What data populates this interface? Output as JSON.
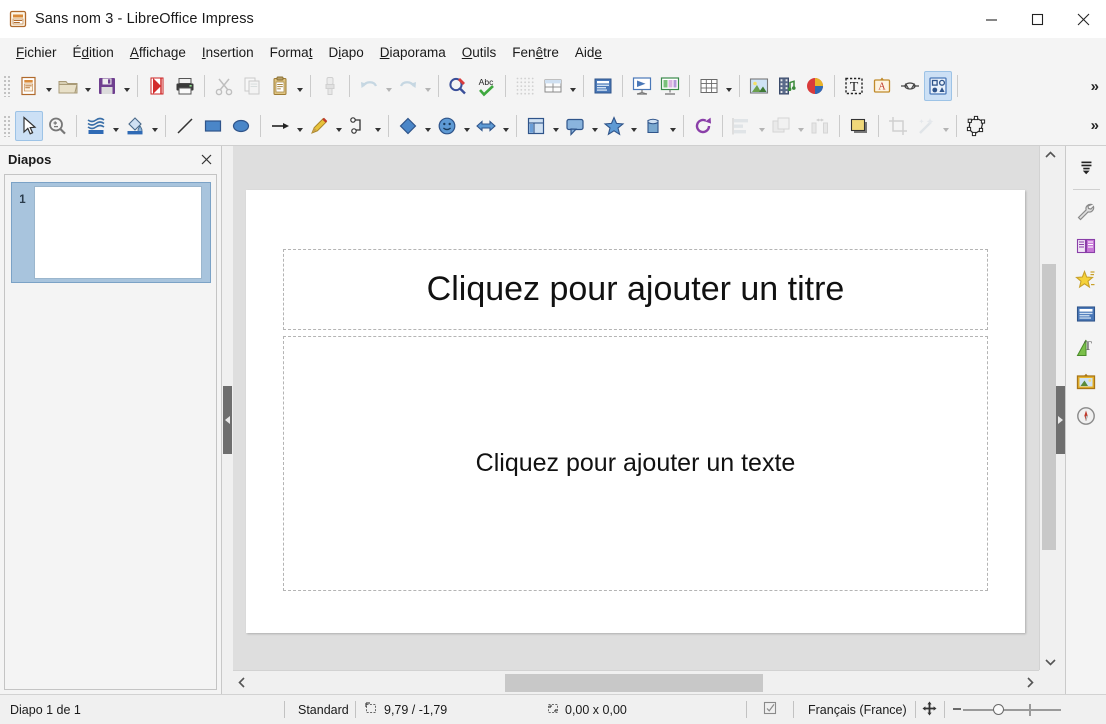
{
  "window": {
    "title": "Sans nom 3 - LibreOffice Impress",
    "app_icon": "impress-document-icon",
    "minimize_label": "—",
    "maximize_label": "□",
    "close_label": "✕"
  },
  "menubar": {
    "items": [
      {
        "name": "menu-fichier",
        "label": "Fichier",
        "accel_index": 0
      },
      {
        "name": "menu-edition",
        "label": "Édition",
        "accel_index": 1
      },
      {
        "name": "menu-affichage",
        "label": "Affichage",
        "accel_index": 0
      },
      {
        "name": "menu-insertion",
        "label": "Insertion",
        "accel_index": 0
      },
      {
        "name": "menu-format",
        "label": "Format",
        "accel_index": 5
      },
      {
        "name": "menu-diapo",
        "label": "Diapo",
        "accel_index": 1
      },
      {
        "name": "menu-diaporama",
        "label": "Diaporama",
        "accel_index": 0
      },
      {
        "name": "menu-outils",
        "label": "Outils",
        "accel_index": 0
      },
      {
        "name": "menu-fenetre",
        "label": "Fenêtre",
        "accel_index": 3
      },
      {
        "name": "menu-aide",
        "label": "Aide",
        "accel_index": 3
      }
    ]
  },
  "toolbar_standard": {
    "overflow_label": "»",
    "buttons": [
      {
        "name": "new-document-button",
        "icon": "new-document-icon",
        "dropdown": true,
        "enabled": true
      },
      {
        "name": "open-button",
        "icon": "open-folder-icon",
        "dropdown": true,
        "enabled": true
      },
      {
        "name": "save-button",
        "icon": "floppy-save-icon",
        "dropdown": true,
        "enabled": true
      },
      {
        "name": "export-pdf-button",
        "icon": "pdf-export-icon",
        "enabled": true
      },
      {
        "name": "print-button",
        "icon": "printer-icon",
        "enabled": true
      },
      {
        "name": "cut-button",
        "icon": "scissors-icon",
        "enabled": false
      },
      {
        "name": "copy-button",
        "icon": "copy-icon",
        "enabled": false
      },
      {
        "name": "paste-button",
        "icon": "clipboard-paste-icon",
        "dropdown": true,
        "enabled": true
      },
      {
        "name": "clone-formatting-button",
        "icon": "paintbrush-icon",
        "enabled": false
      },
      {
        "name": "undo-button",
        "icon": "undo-arrow-icon",
        "dropdown": true,
        "enabled": false
      },
      {
        "name": "redo-button",
        "icon": "redo-arrow-icon",
        "dropdown": true,
        "enabled": false
      },
      {
        "name": "find-replace-button",
        "icon": "magnifier-pencil-icon",
        "enabled": true
      },
      {
        "name": "spelling-button",
        "icon": "abc-check-icon",
        "enabled": true
      },
      {
        "name": "display-grid-button",
        "icon": "grid-dots-icon",
        "enabled": false
      },
      {
        "name": "display-views-button",
        "icon": "table-view-icon",
        "dropdown": true,
        "enabled": true
      },
      {
        "name": "master-slide-button",
        "icon": "master-slide-icon",
        "enabled": true
      },
      {
        "name": "start-from-first-slide-button",
        "icon": "presentation-screen-icon",
        "enabled": true
      },
      {
        "name": "start-from-current-slide-button",
        "icon": "presentation-columns-icon",
        "enabled": true
      },
      {
        "name": "insert-table-button",
        "icon": "table-grid-icon",
        "dropdown": true,
        "enabled": true
      },
      {
        "name": "insert-image-button",
        "icon": "picture-icon",
        "enabled": true
      },
      {
        "name": "insert-media-button",
        "icon": "film-audio-icon",
        "enabled": true
      },
      {
        "name": "insert-chart-button",
        "icon": "pie-chart-icon",
        "enabled": true
      },
      {
        "name": "insert-text-box-button",
        "icon": "text-box-icon",
        "enabled": true
      },
      {
        "name": "fontwork-button",
        "icon": "fontwork-a-icon",
        "enabled": true
      },
      {
        "name": "hyperlink-button",
        "icon": "hyperlink-chain-icon",
        "enabled": true
      },
      {
        "name": "gallery-button",
        "icon": "gallery-shapes-icon",
        "enabled": true,
        "active": true
      }
    ]
  },
  "toolbar_drawing": {
    "overflow_label": "»",
    "buttons": [
      {
        "name": "select-tool-button",
        "icon": "cursor-arrow-icon",
        "enabled": true,
        "active": true
      },
      {
        "name": "zoom-tool-button",
        "icon": "zoom-magnifier-icon",
        "enabled": true
      },
      {
        "name": "line-color-button",
        "icon": "line-color-icon",
        "dropdown": true,
        "enabled": true
      },
      {
        "name": "fill-color-button",
        "icon": "fill-color-bucket-icon",
        "dropdown": true,
        "enabled": true
      },
      {
        "name": "insert-line-button",
        "icon": "diagonal-line-icon",
        "enabled": true
      },
      {
        "name": "insert-rectangle-button",
        "icon": "rectangle-icon",
        "enabled": true
      },
      {
        "name": "insert-ellipse-button",
        "icon": "ellipse-icon",
        "enabled": true
      },
      {
        "name": "insert-arrow-button",
        "icon": "line-arrow-icon",
        "dropdown": true,
        "enabled": true
      },
      {
        "name": "curves-and-polygons-button",
        "icon": "pencil-curve-icon",
        "dropdown": true,
        "enabled": true
      },
      {
        "name": "connectors-button",
        "icon": "connector-icon",
        "dropdown": true,
        "enabled": true
      },
      {
        "name": "basic-shapes-button",
        "icon": "diamond-shape-icon",
        "dropdown": true,
        "enabled": true
      },
      {
        "name": "symbol-shapes-button",
        "icon": "smiley-face-icon",
        "dropdown": true,
        "enabled": true
      },
      {
        "name": "block-arrows-button",
        "icon": "block-arrow-icon",
        "dropdown": true,
        "enabled": true
      },
      {
        "name": "flowchart-shapes-button",
        "icon": "flowchart-icon",
        "dropdown": true,
        "enabled": true
      },
      {
        "name": "callout-shapes-button",
        "icon": "callout-bubble-icon",
        "dropdown": true,
        "enabled": true
      },
      {
        "name": "stars-shapes-button",
        "icon": "star-shape-icon",
        "dropdown": true,
        "enabled": true
      },
      {
        "name": "three-d-objects-button",
        "icon": "3d-cube-icon",
        "dropdown": true,
        "enabled": true
      },
      {
        "name": "rotate-button",
        "icon": "rotate-icon",
        "enabled": true
      },
      {
        "name": "align-objects-button",
        "icon": "align-left-icon",
        "dropdown": true,
        "enabled": false
      },
      {
        "name": "arrange-button",
        "icon": "arrange-stack-icon",
        "dropdown": true,
        "enabled": false
      },
      {
        "name": "distribute-button",
        "icon": "distribute-icon",
        "enabled": false
      },
      {
        "name": "shadow-button",
        "icon": "shadow-square-icon",
        "enabled": true
      },
      {
        "name": "crop-image-button",
        "icon": "crop-icon",
        "enabled": false
      },
      {
        "name": "filter-button",
        "icon": "magic-wand-filter-icon",
        "dropdown": true,
        "enabled": false
      },
      {
        "name": "edit-points-button",
        "icon": "edit-points-polygon-icon",
        "enabled": true
      }
    ]
  },
  "slide_panel": {
    "title": "Diapos",
    "close_label": "✕",
    "slides": [
      {
        "number": "1",
        "selected": true
      }
    ]
  },
  "slide": {
    "title_placeholder": "Cliquez pour ajouter un titre",
    "content_placeholder": "Cliquez pour ajouter un texte"
  },
  "sidebar": {
    "items": [
      {
        "name": "sidebar-settings-button",
        "icon": "sidebar-settings-icon"
      },
      {
        "name": "sidebar-item-properties",
        "icon": "wrench-properties-icon"
      },
      {
        "name": "sidebar-item-slide-transition",
        "icon": "slide-transition-icon"
      },
      {
        "name": "sidebar-item-animation",
        "icon": "star-animation-icon"
      },
      {
        "name": "sidebar-item-master-slides",
        "icon": "master-slides-icon"
      },
      {
        "name": "sidebar-item-styles",
        "icon": "styles-t-icon"
      },
      {
        "name": "sidebar-item-gallery",
        "icon": "gallery-picture-icon"
      },
      {
        "name": "sidebar-item-navigator",
        "icon": "navigator-compass-icon"
      }
    ]
  },
  "statusbar": {
    "slide_count": "Diapo 1 de 1",
    "master": "Standard",
    "cursor_position": "9,79 / -1,79",
    "object_size": "0,00 x 0,00",
    "save_state_icon": "document-modified-icon",
    "language": "Français (France)",
    "fit_slide_icon": "fit-slide-to-window-icon",
    "zoom_minus": "−",
    "zoom_plus": "+"
  },
  "scrollbars": {
    "v_up": "▲",
    "v_down": "▼",
    "h_left": "‹",
    "h_right": "›"
  },
  "colors": {
    "accent_blue": "#cce0f5",
    "thumb_selected": "#a8c4dd",
    "canvas_gray": "#dedede",
    "toolbar_bg": "#f4f4f4"
  }
}
